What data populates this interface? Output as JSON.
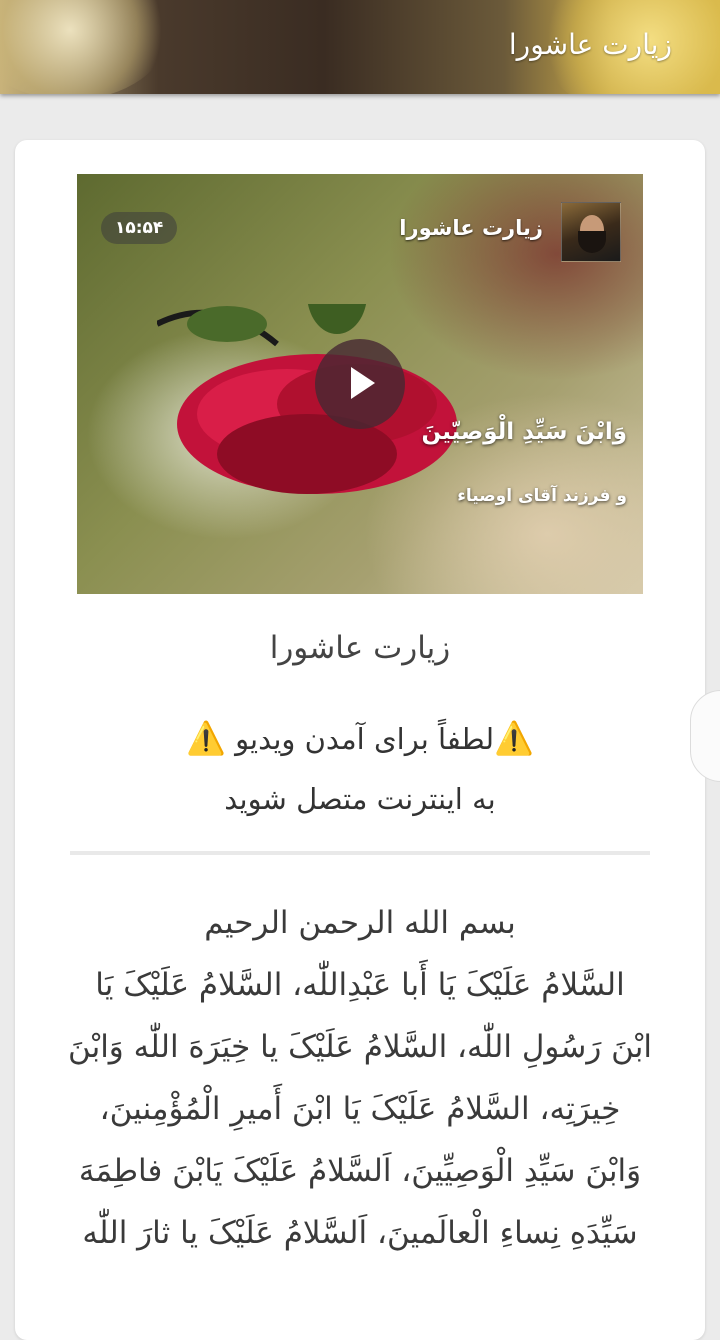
{
  "appbar": {
    "title": "زیارت عاشورا"
  },
  "video": {
    "duration": "۱۵:۵۴",
    "title": "زیارت عاشورا",
    "caption_arabic": "وَابْنَ سَیِّدِ الْوَصِیّینَ",
    "caption_persian": "و فرزند آقای اوصیاء"
  },
  "content": {
    "heading": "زیارت عاشورا",
    "notice_line1": "لطفاً برای آمدن ویدیو",
    "notice_line2": "به اینترنت متصل شوید",
    "warning_icon": "⚠️",
    "text_lines": [
      "بسم الله الرحمن الرحیم",
      "السَّلامُ عَلَیْکَ یَا أَبا عَبْدِاللّٰه، السَّلامُ عَلَیْکَ یَا",
      "ابْنَ رَسُولِ اللّٰه، السَّلامُ عَلَیْکَ یا خِیَرَهَ اللّٰه وَابْنَ",
      "خِیرَتِه، السَّلامُ عَلَیْکَ یَا ابْنَ أَمیرِ الْمُؤْمِنینَ،",
      "وَابْنَ سَیِّدِ الْوَصِیِّینَ، اَلسَّلامُ عَلَیْکَ یَابْنَ فاطِمَهَ",
      "سَیِّدَهِ نِساءِ الْعالَمینَ، اَلسَّلامُ عَلَیْکَ یا ثارَ اللّٰه"
    ]
  },
  "colors": {
    "appbar_accent": "#3a2c22",
    "card_bg": "#ffffff",
    "page_bg": "#ebebeb"
  }
}
